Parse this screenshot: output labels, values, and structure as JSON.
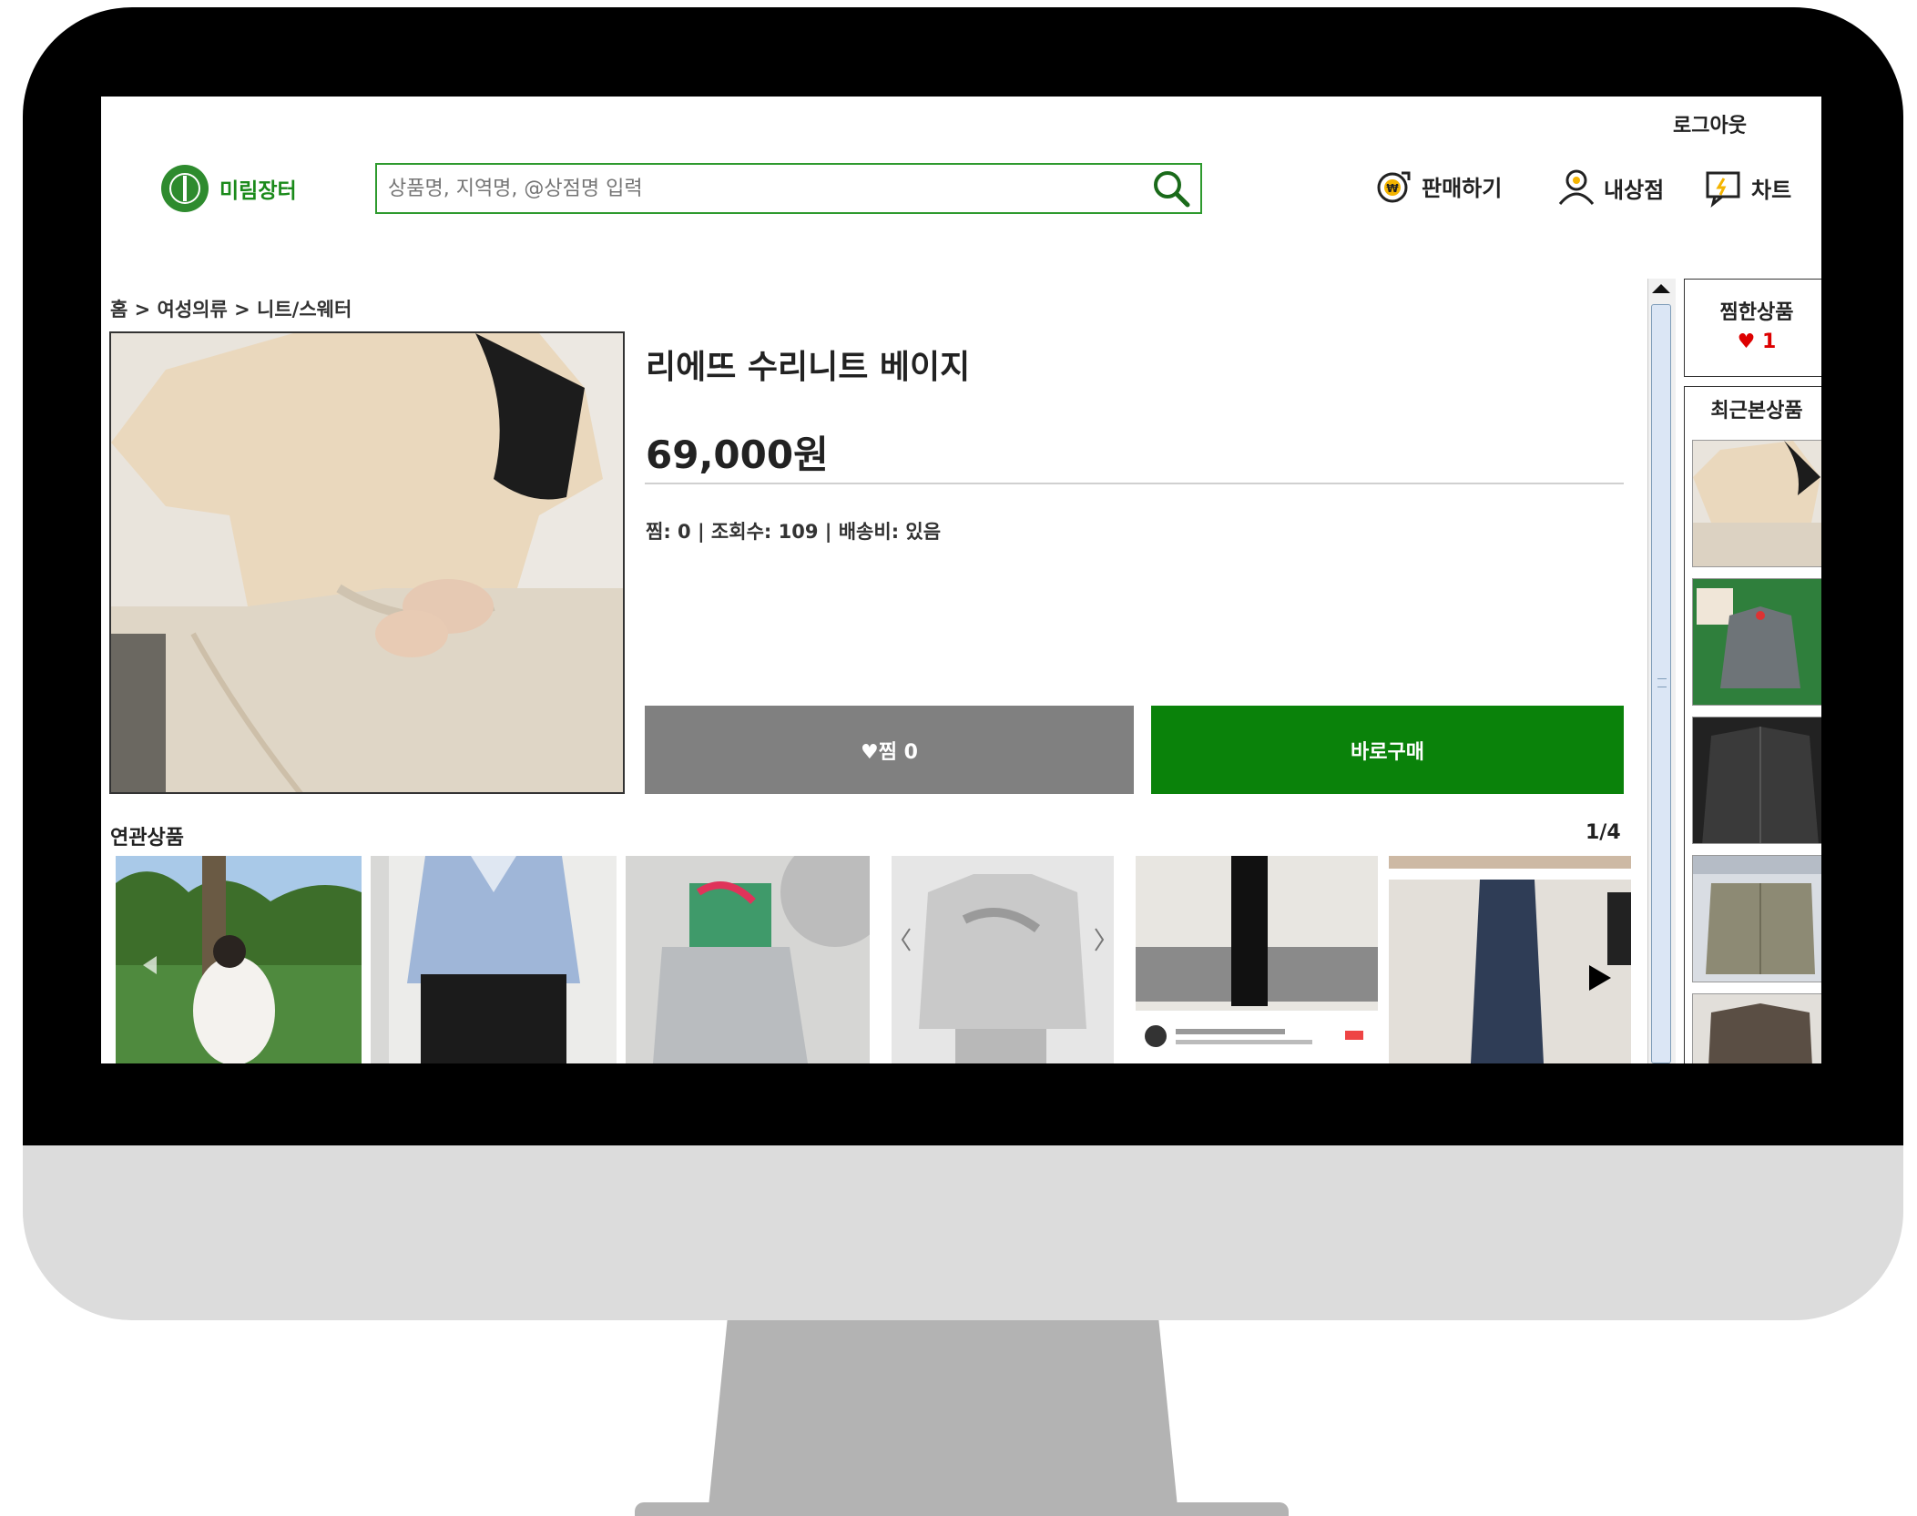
{
  "header": {
    "logout": "로그아웃",
    "brand": "미림장터",
    "search_placeholder": "상품명, 지역명, @상점명 입력",
    "nav": {
      "sell": "판매하기",
      "my_store": "내상점",
      "chat": "차트"
    }
  },
  "breadcrumb": "홈 > 여성의류 > 니트/스웨터",
  "product": {
    "title": "리에뜨 수리니트 베이지",
    "price": "69,000원",
    "stats": "찜: 0 | 조회수: 109 | 배송비: 있음",
    "like_button": "♥찜 0",
    "buy_button": "바로구매"
  },
  "related": {
    "title": "연관상품",
    "page": "1/4"
  },
  "sidebar": {
    "wish_title": "찜한상품",
    "wish_count": "♥ 1",
    "recent_title": "최근본상품"
  },
  "colors": {
    "brand_green": "#0a820a",
    "like_gray": "#808080",
    "heart_red": "#dd0000"
  }
}
